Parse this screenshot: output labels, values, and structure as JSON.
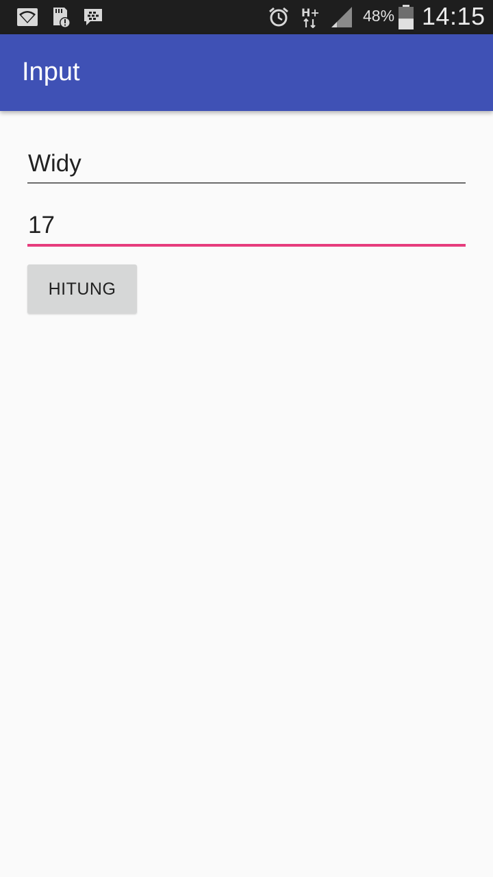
{
  "status_bar": {
    "icons": [
      "wifi-icon",
      "sd-card-alert-icon",
      "bbm-icon",
      "alarm-icon",
      "hplus-data-icon",
      "signal-icon",
      "battery-icon"
    ],
    "battery_percent": "48%",
    "time": "14:15",
    "battery_level": 0.48
  },
  "app_bar": {
    "title": "Input",
    "color": "#3f51b5"
  },
  "form": {
    "name_value": "Widy",
    "age_value": "17",
    "focus_color": "#e63c7d",
    "button_label": "HITUNG"
  }
}
